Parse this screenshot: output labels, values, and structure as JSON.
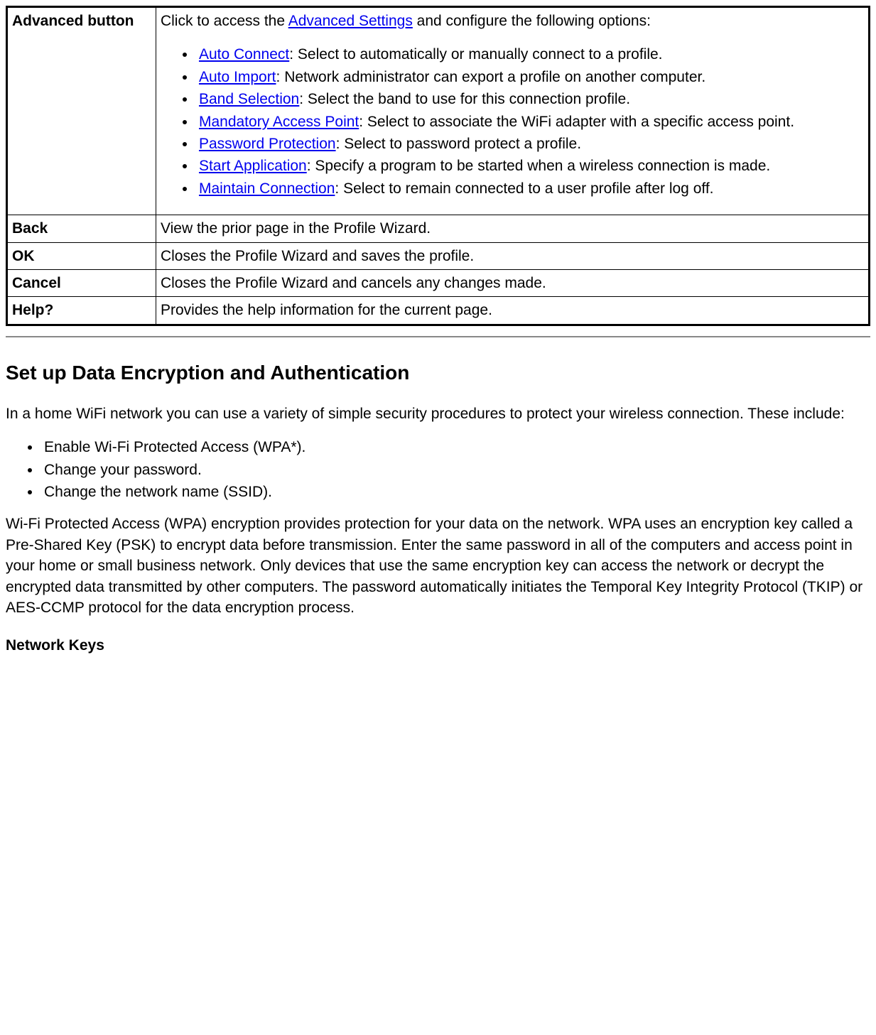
{
  "table": {
    "rows": [
      {
        "label": "Advanced button",
        "intro_prefix": "Click to access the ",
        "intro_link": "Advanced Settings",
        "intro_suffix": " and configure the following options:",
        "items": [
          {
            "link": "Auto Connect",
            "text": ": Select to automatically or manually connect to a profile."
          },
          {
            "link": "Auto Import",
            "text": ": Network administrator can export a profile on another computer."
          },
          {
            "link": "Band Selection",
            "text": ": Select the band to use for this connection profile."
          },
          {
            "link": "Mandatory Access Point",
            "text": ": Select to associate the WiFi adapter with a specific access point."
          },
          {
            "link": "Password Protection",
            "text": ": Select to password protect a profile."
          },
          {
            "link": "Start Application",
            "text": ": Specify a program to be started when a wireless connection is made."
          },
          {
            "link": "Maintain Connection",
            "text": ": Select to remain connected to a user profile after log off."
          }
        ]
      },
      {
        "label": "Back",
        "desc": "View the prior page in the Profile Wizard."
      },
      {
        "label": "OK",
        "desc": "Closes the Profile Wizard and saves the profile."
      },
      {
        "label": "Cancel",
        "desc": "Closes the Profile Wizard and cancels any changes made."
      },
      {
        "label": "Help?",
        "desc": "Provides the help information for the current page."
      }
    ]
  },
  "section": {
    "heading": "Set up Data Encryption and Authentication",
    "para1": "In a home WiFi network you can use a variety of simple security procedures to protect your wireless connection. These include:",
    "bullets": [
      "Enable Wi-Fi Protected Access (WPA*).",
      "Change your password.",
      "Change the network name (SSID)."
    ],
    "para2": "Wi-Fi Protected Access (WPA) encryption provides protection for your data on the network. WPA uses an encryption key called a Pre-Shared Key (PSK) to encrypt data before transmission. Enter the same password in all of the computers and access point in your home or small business network. Only devices that use the same encryption key can access the network or decrypt the encrypted data transmitted by other computers. The password automatically initiates the Temporal Key Integrity Protocol (TKIP) or AES-CCMP protocol for the data encryption process.",
    "subheading": "Network Keys"
  }
}
